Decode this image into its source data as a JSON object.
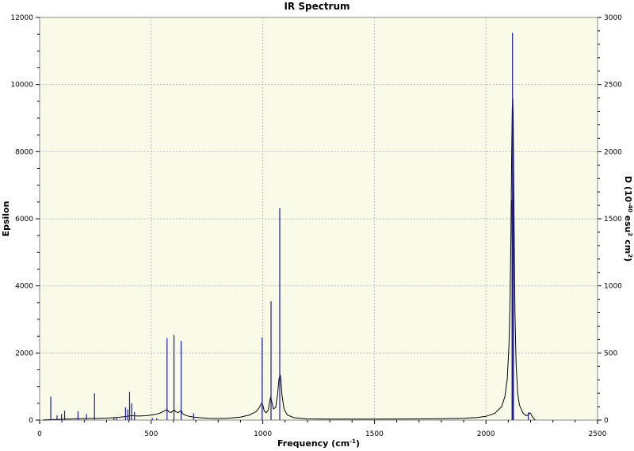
{
  "chart_data": {
    "type": "line",
    "title": "IR Spectrum",
    "xlabel": {
      "main": "Frequency (cm",
      "sup": "-1",
      "end": ")"
    },
    "ylabel": "Epsilon",
    "y2label": {
      "p1": "D (10",
      "s1": "-40",
      "p2": " esu",
      "s2": "2",
      "p3": " cm",
      "s3": "2",
      "p4": ")"
    },
    "xlim": [
      0,
      2500
    ],
    "ylim": [
      0,
      12000
    ],
    "y2lim": [
      0,
      3000
    ],
    "xticks": [
      0,
      500,
      1000,
      1500,
      2000,
      2500
    ],
    "yticks": [
      0,
      2000,
      4000,
      6000,
      8000,
      10000,
      12000
    ],
    "y2ticks": [
      0,
      500,
      1000,
      1500,
      2000,
      2500,
      3000
    ],
    "grid": true,
    "colors": {
      "plot_bg": "#fafae9",
      "spectrum": "#000000",
      "sticks": "#1c1c9c",
      "grid": "#bdbdbd"
    },
    "series": [
      {
        "kind": "spectrum",
        "y_axis": "left",
        "x": [
          15,
          40,
          60,
          80,
          100,
          120,
          150,
          180,
          200,
          240,
          260,
          300,
          330,
          350,
          380,
          400,
          410,
          420,
          440,
          480,
          500,
          520,
          540,
          555,
          565,
          572,
          580,
          590,
          600,
          604,
          610,
          620,
          630,
          635,
          640,
          650,
          670,
          690,
          720,
          760,
          800,
          850,
          900,
          940,
          970,
          985,
          992,
          996,
          1000,
          1006,
          1015,
          1025,
          1032,
          1036,
          1040,
          1048,
          1058,
          1066,
          1072,
          1077,
          1080,
          1086,
          1095,
          1110,
          1140,
          1200,
          1300,
          1400,
          1500,
          1600,
          1700,
          1800,
          1900,
          1960,
          2000,
          2040,
          2070,
          2085,
          2095,
          2103,
          2108,
          2112,
          2115,
          2118,
          2120,
          2122,
          2124,
          2127,
          2130,
          2135,
          2142,
          2150,
          2165,
          2180,
          2190,
          2195,
          2200,
          2208,
          2215,
          2220
        ],
        "y": [
          0,
          10,
          15,
          20,
          25,
          30,
          35,
          40,
          45,
          50,
          50,
          60,
          70,
          80,
          100,
          120,
          130,
          130,
          120,
          130,
          150,
          170,
          210,
          260,
          300,
          310,
          240,
          230,
          290,
          300,
          250,
          220,
          270,
          280,
          200,
          150,
          110,
          90,
          70,
          55,
          45,
          60,
          90,
          150,
          250,
          380,
          480,
          500,
          450,
          280,
          220,
          300,
          600,
          700,
          550,
          330,
          380,
          750,
          1200,
          1350,
          1300,
          750,
          330,
          150,
          70,
          35,
          30,
          30,
          30,
          32,
          35,
          40,
          55,
          75,
          110,
          200,
          400,
          700,
          1200,
          2200,
          3500,
          5500,
          7800,
          9300,
          9600,
          9000,
          7500,
          5000,
          3200,
          1700,
          800,
          450,
          220,
          130,
          150,
          220,
          200,
          100,
          40,
          0
        ]
      },
      {
        "kind": "sticks",
        "y_axis": "right",
        "x": [
          50,
          78,
          98,
          112,
          172,
          210,
          246,
          333,
          345,
          385,
          395,
          403,
          412,
          425,
          505,
          525,
          571,
          602,
          634,
          690,
          997,
          1037,
          1076,
          2117,
          2119,
          2121,
          2123,
          2190
        ],
        "y": [
          175,
          35,
          45,
          70,
          65,
          45,
          200,
          15,
          15,
          95,
          80,
          210,
          125,
          60,
          15,
          15,
          610,
          635,
          590,
          50,
          615,
          885,
          1580,
          1640,
          2885,
          2250,
          1965,
          55
        ]
      }
    ]
  }
}
